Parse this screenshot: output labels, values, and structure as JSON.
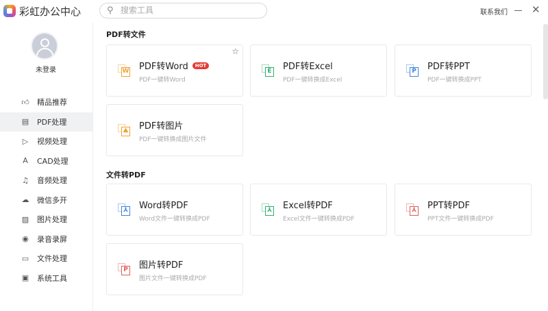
{
  "app": {
    "title": "彩虹办公中心",
    "contact": "联系我们"
  },
  "search": {
    "placeholder": "搜索工具"
  },
  "user": {
    "status": "未登录"
  },
  "sidebar": {
    "items": [
      {
        "label": "精品推荐",
        "icon": "thumbs-up-icon"
      },
      {
        "label": "PDF处理",
        "icon": "pdf-icon",
        "active": true
      },
      {
        "label": "视频处理",
        "icon": "video-icon"
      },
      {
        "label": "CAD处理",
        "icon": "cad-icon"
      },
      {
        "label": "音频处理",
        "icon": "music-icon"
      },
      {
        "label": "微信多开",
        "icon": "wechat-icon"
      },
      {
        "label": "图片处理",
        "icon": "image-icon"
      },
      {
        "label": "录音录屏",
        "icon": "record-icon"
      },
      {
        "label": "文件处理",
        "icon": "folder-icon"
      },
      {
        "label": "系统工具",
        "icon": "monitor-icon"
      }
    ]
  },
  "sections": [
    {
      "title": "PDF转文件",
      "cards": [
        {
          "title": "PDF转Word",
          "desc": "PDF一键转Word",
          "badge": "HOT",
          "glyph": "W",
          "color": "#f0a030"
        },
        {
          "title": "PDF转Excel",
          "desc": "PDF一键转换成Excel",
          "glyph": "E",
          "color": "#2fae6e"
        },
        {
          "title": "PDF转PPT",
          "desc": "PDF一键转换成PPT",
          "glyph": "P",
          "color": "#3d84d8"
        },
        {
          "title": "PDF转图片",
          "desc": "PDF一键转换成图片文件",
          "glyph": "⛰",
          "color": "#f0a030"
        }
      ]
    },
    {
      "title": "文件转PDF",
      "cards": [
        {
          "title": "Word转PDF",
          "desc": "Word文件一键转换成PDF",
          "glyph": "⅄",
          "color": "#3d84d8"
        },
        {
          "title": "Excel转PDF",
          "desc": "Excel文件一键转换成PDF",
          "glyph": "⅄",
          "color": "#2fae6e"
        },
        {
          "title": "PPT转PDF",
          "desc": "PPT文件一键转换成PDF",
          "glyph": "⅄",
          "color": "#e05a5a"
        },
        {
          "title": "图片转PDF",
          "desc": "图片文件一键转换成PDF",
          "glyph": "P",
          "color": "#e05a5a"
        }
      ]
    }
  ]
}
